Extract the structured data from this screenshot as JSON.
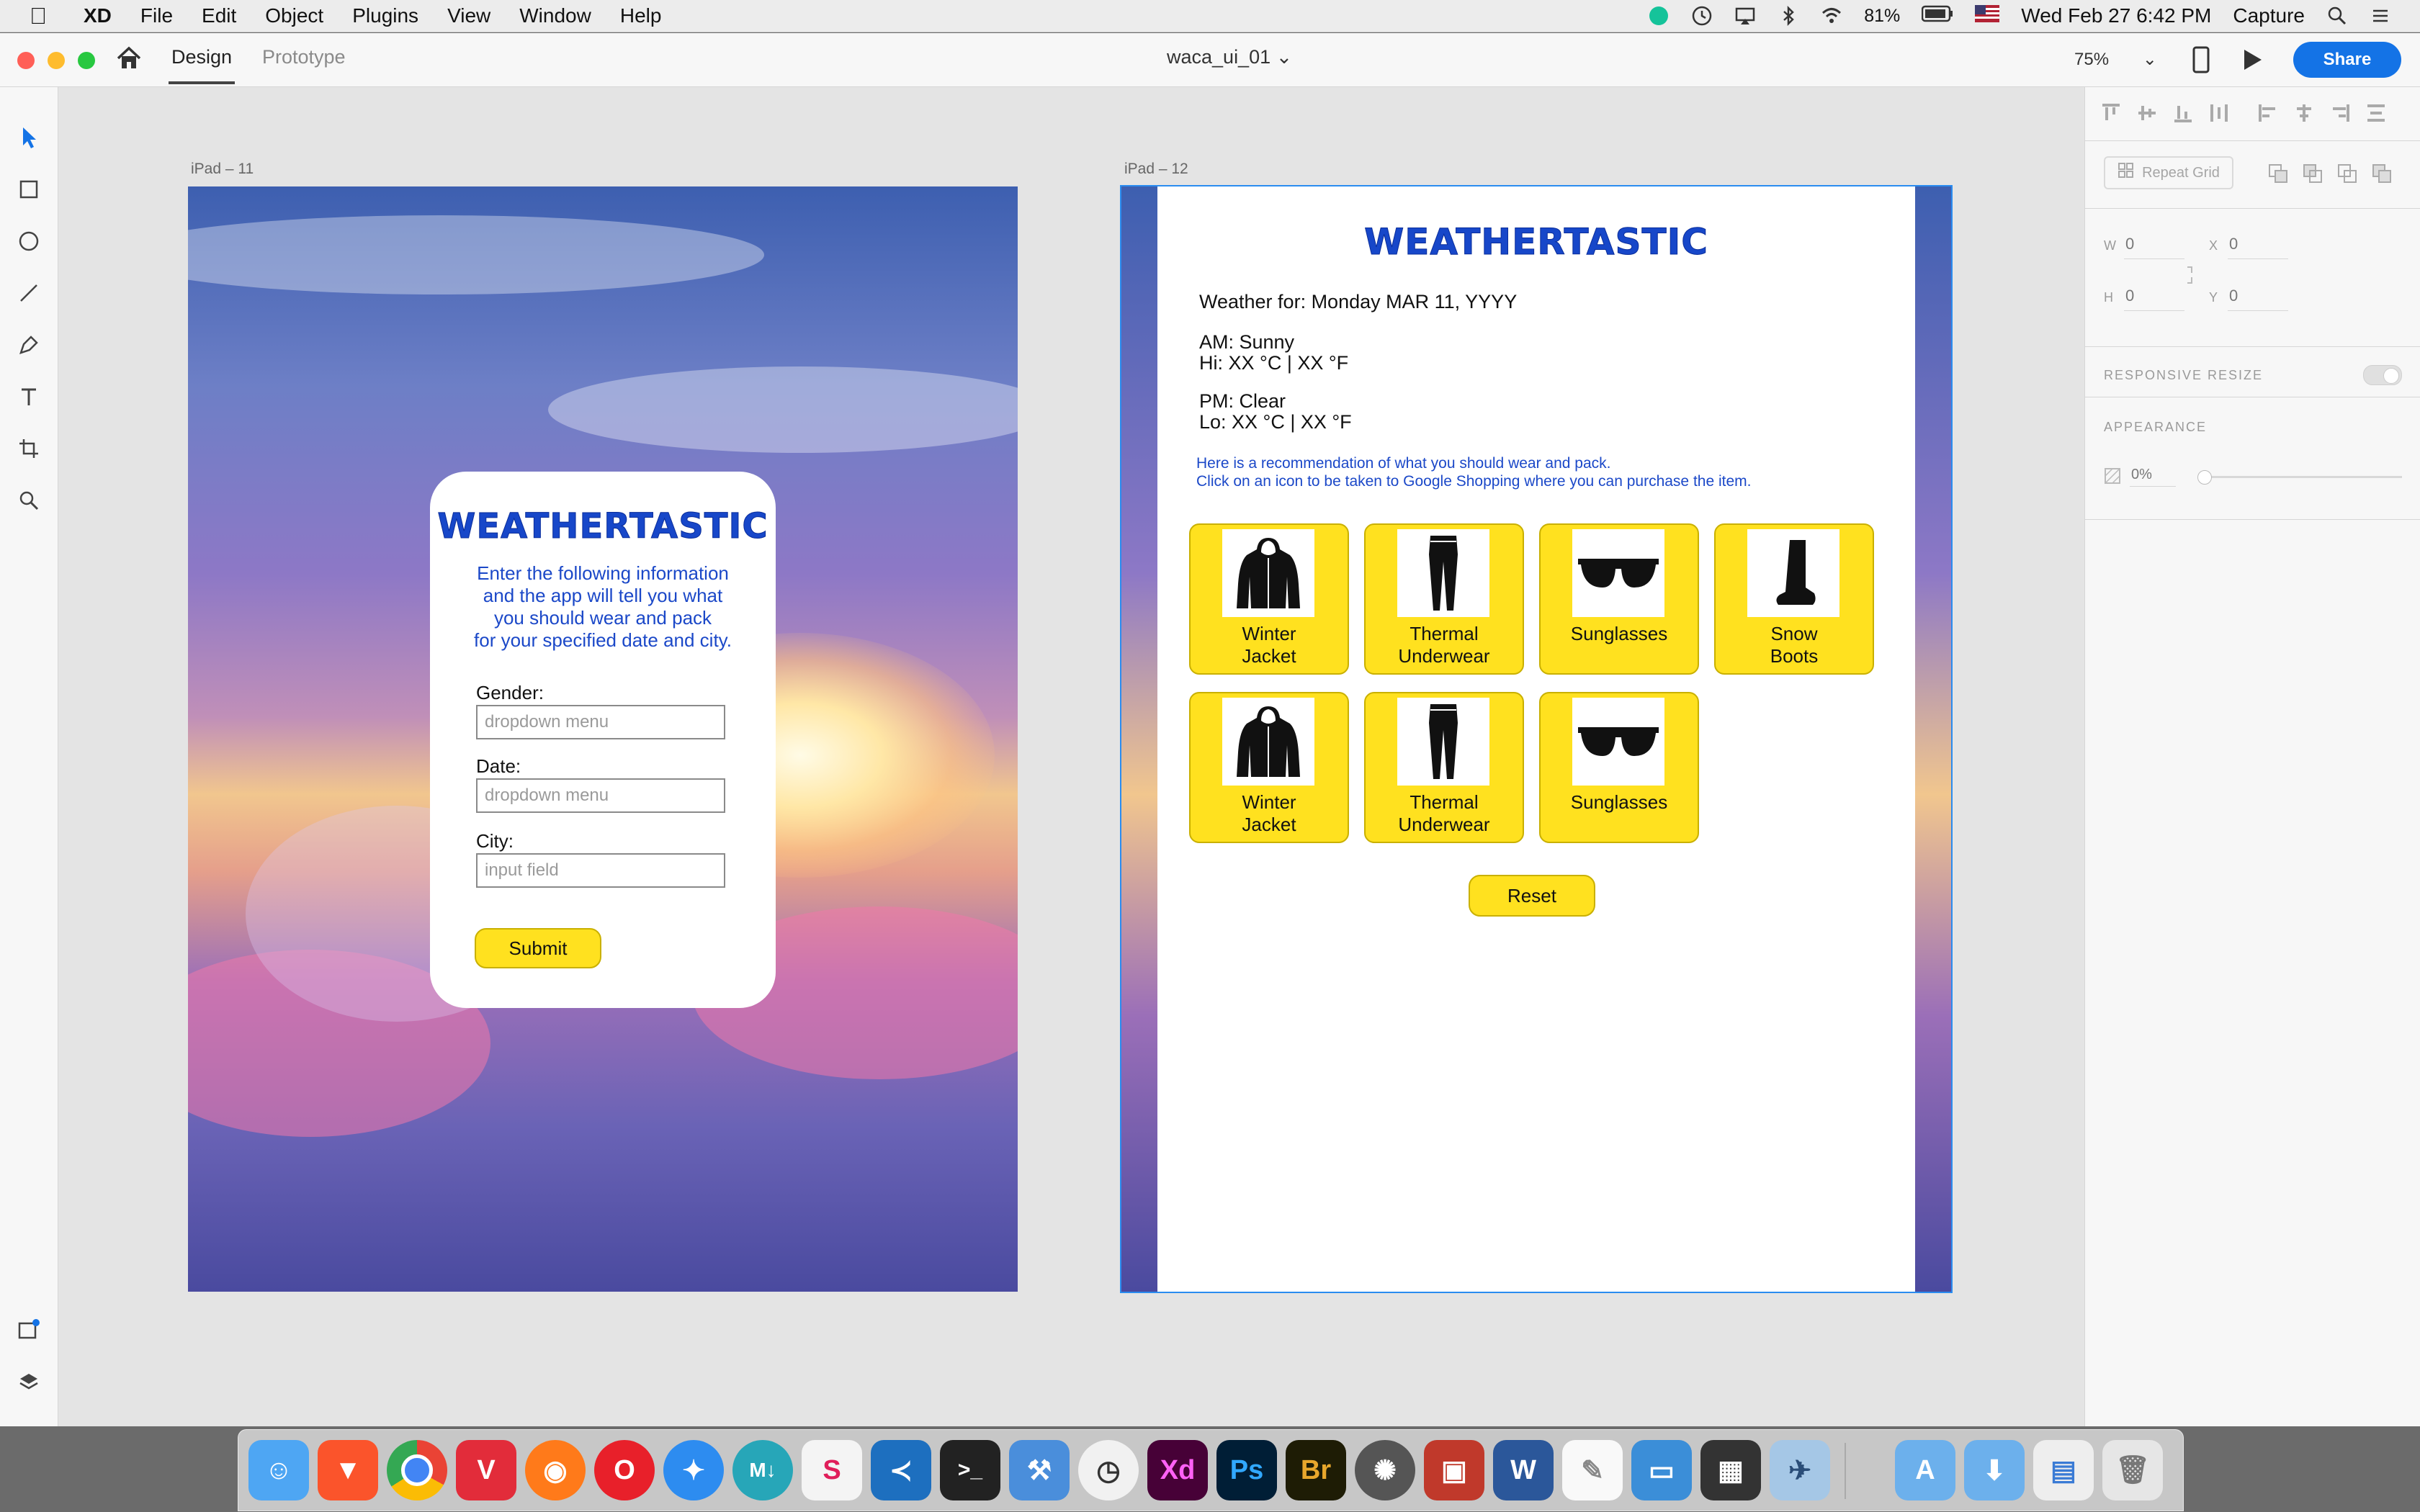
{
  "menubar": {
    "app": "XD",
    "items": [
      "File",
      "Edit",
      "Object",
      "Plugins",
      "View",
      "Window",
      "Help"
    ],
    "battery": "81%",
    "datetime": "Wed Feb 27  6:42 PM",
    "capture": "Capture"
  },
  "titlebar": {
    "tabs": [
      "Design",
      "Prototype"
    ],
    "doc_title": "waca_ui_01",
    "zoom": "75%",
    "share": "Share"
  },
  "artboard1": {
    "label": "iPad – 11",
    "brand": "WEATHERTASTIC",
    "description": "Enter the following information\nand the app will tell you what\nyou should wear and pack\nfor your specified date and city.",
    "fields": [
      {
        "label": "Gender:",
        "placeholder": "dropdown menu"
      },
      {
        "label": "Date:",
        "placeholder": "dropdown menu"
      },
      {
        "label": "City:",
        "placeholder": "input field"
      }
    ],
    "submit": "Submit"
  },
  "artboard2": {
    "label": "iPad – 12",
    "brand": "WEATHERTASTIC",
    "weather_for": "Weather for: Monday MAR 11, YYYY",
    "am": "AM: Sunny\nHi: XX °C | XX °F",
    "pm": "PM: Clear\nLo: XX °C | XX °F",
    "recommendation": "Here is a recommendation of what you should wear and pack.\nClick on an icon to be taken to Google Shopping where you can purchase the item.",
    "items": [
      {
        "label": "Winter\nJacket",
        "icon": "jacket-icon"
      },
      {
        "label": "Thermal\nUnderwear",
        "icon": "pants-icon"
      },
      {
        "label": "Sunglasses",
        "icon": "sunglasses-icon"
      },
      {
        "label": "Snow\nBoots",
        "icon": "boot-icon"
      },
      {
        "label": "Winter\nJacket",
        "icon": "jacket-icon"
      },
      {
        "label": "Thermal\nUnderwear",
        "icon": "pants-icon"
      },
      {
        "label": "Sunglasses",
        "icon": "sunglasses-icon"
      }
    ],
    "reset": "Reset"
  },
  "rightpanel": {
    "repeat_grid": "Repeat Grid",
    "w_label": "W",
    "w_value": "0",
    "x_label": "X",
    "x_value": "0",
    "h_label": "H",
    "h_value": "0",
    "y_label": "Y",
    "y_value": "0",
    "responsive_resize": "RESPONSIVE RESIZE",
    "appearance": "APPEARANCE",
    "opacity": "0%"
  },
  "colors": {
    "accent": "#1473e6",
    "brand_blue": "#1747c9",
    "button_yellow": "#ffe11f"
  }
}
